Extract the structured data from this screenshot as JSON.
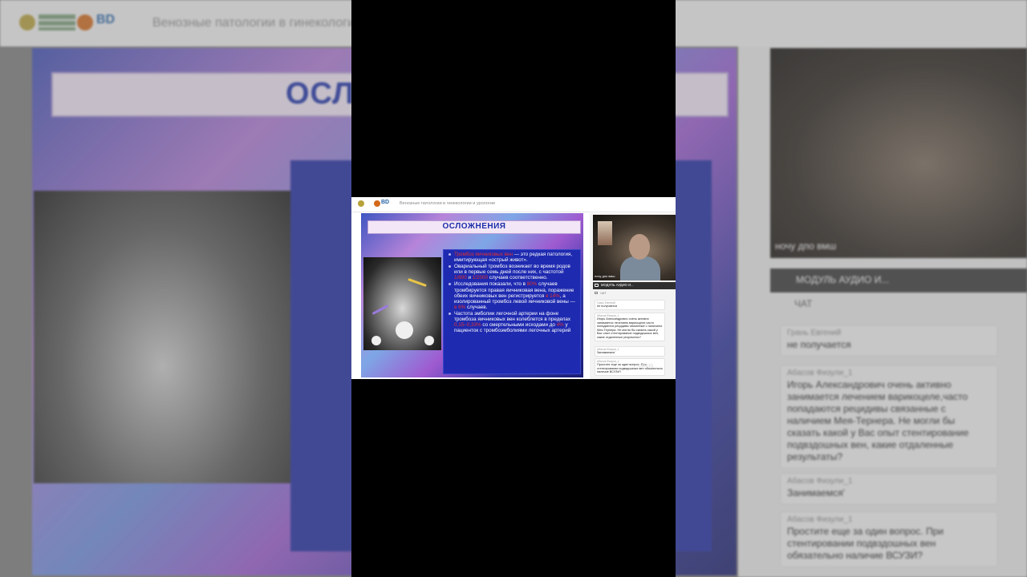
{
  "app": {
    "brand_logo": "BD",
    "page_title": "Венозные патологии в гинекологии и урологии"
  },
  "slide": {
    "title": "ОСЛОЖНЕНИЯ",
    "bullets": [
      {
        "red": "Тромбоз яичниковых вен",
        "text": " — это редкая патология, имитирующая «острый живот»."
      },
      {
        "text": "Овариальный тромбоз возникает во время родов или в первые семь дней после них, с частотой ",
        "red": "1/600",
        "text2": " и ",
        "red2": "1/2000",
        "text3": " случаев соответственно."
      },
      {
        "text": " Исследования показали, что в ",
        "red": "80%",
        "text2": " случаев тромбируется правая яичниковая вена, поражение обеих яичниковых вен регистрируется ",
        "red2": "в 14%",
        "text3": ", а изолированный тромбоз левой яичниковой вены — ",
        "red3": "в 6%",
        "text4": " случаев."
      },
      {
        "text": "Частота эмболии легочной артерии на фоне тромбоза яичниковых вен колеблется в пределах ",
        "red": "0,15–0,33%",
        "text2": " со смертельными исходами до ",
        "red2": "4%",
        "text3": " у пациенток с тромбоэмболиями легочных артерий"
      }
    ]
  },
  "video": {
    "participant_label": "ночу дпо вмш"
  },
  "audio": {
    "label": "МОДУЛЬ АУДИО И..."
  },
  "chat": {
    "tab_label": "ЧАТ",
    "messages": [
      {
        "author": "Грань Евгений",
        "text": "не получается"
      },
      {
        "author": "Абасов Физули_1",
        "text": "Игорь Александрович очень активно занимается лечением варикоцеле,часто попадаются рецидивы связанные с наличием Мея-Тернера. Не могли бы сказать какой у Вас опыт стентирование подвздошных вен, какие отдаленные результаты?"
      },
      {
        "author": "Абасов Физули_1",
        "text": "Занимаемся'"
      },
      {
        "author": "Абасов Физули_1",
        "text": "Простите еще за один вопрос. При стентировании подвздошных вен обязательно наличие ВСУЗИ?"
      }
    ],
    "watermark": "eeting"
  },
  "colors": {
    "frame": "#000000",
    "slide_title": "#1a2ea8",
    "text_panel": "#1e2ab0",
    "highlight_red": "#e3322f"
  },
  "icons": [
    "logo-emblem-icon",
    "logo-circle-icon",
    "mic-icon",
    "camera-icon",
    "chat-icon"
  ]
}
